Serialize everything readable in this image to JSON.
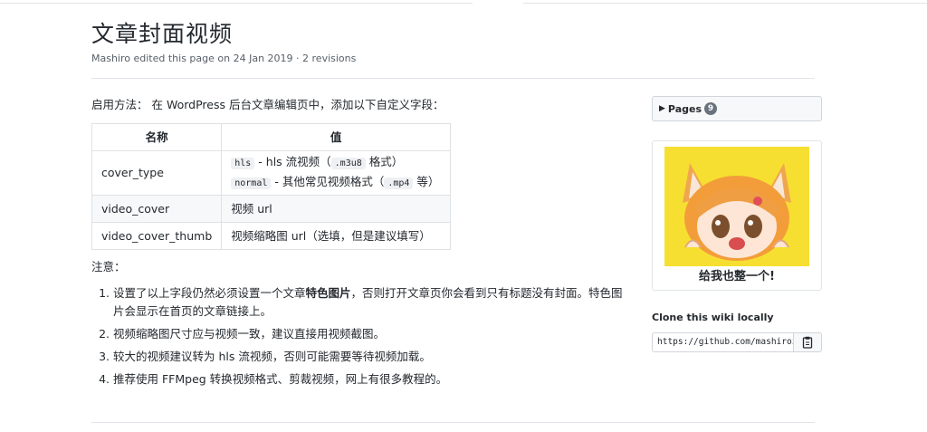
{
  "page": {
    "title": "文章封面视频",
    "meta": "Mashiro edited this page on 24 Jan 2019 · 2 revisions"
  },
  "content": {
    "intro": "启用方法： 在 WordPress 后台文章编辑页中，添加以下自定义字段：",
    "table": {
      "headers": [
        "名称",
        "值"
      ],
      "rows": [
        {
          "name": "cover_type",
          "values": [
            {
              "code": "hls",
              "text": " - hls 流视频（",
              "code2": ".m3u8",
              "text2": " 格式）"
            },
            {
              "code": "normal",
              "text": " - 其他常见视频格式（",
              "code2": ".mp4",
              "text2": " 等）"
            }
          ]
        },
        {
          "name": "video_cover",
          "value": "视频 url"
        },
        {
          "name": "video_cover_thumb",
          "value": "视频缩略图 url（选填，但是建议填写）"
        }
      ]
    },
    "note_label": "注意：",
    "notes": [
      {
        "pre": "设置了以上字段仍然必须设置一个文章",
        "bold": "特色图片",
        "post": "，否则打开文章页你会看到只有标题没有封面。特色图片会显示在首页的文章链接上。"
      },
      {
        "pre": "视频缩略图尺寸应与视频一致，建议直接用视频截图。",
        "bold": "",
        "post": ""
      },
      {
        "pre": "较大的视频建议转为 hls 流视频，否则可能需要等待视频加载。",
        "bold": "",
        "post": ""
      },
      {
        "pre": "推荐使用 FFMpeg 转换视频格式、剪裁视频，网上有很多教程的。",
        "bold": "",
        "post": ""
      }
    ]
  },
  "sidebar": {
    "pages_label": "Pages",
    "pages_count": "9",
    "image_caption": "给我也整一个!",
    "clone_title": "Clone this wiki locally",
    "clone_url": "https://github.com/mashiroz",
    "icons": {
      "caret": "caret-right-icon",
      "clipboard": "clipboard-icon"
    }
  }
}
